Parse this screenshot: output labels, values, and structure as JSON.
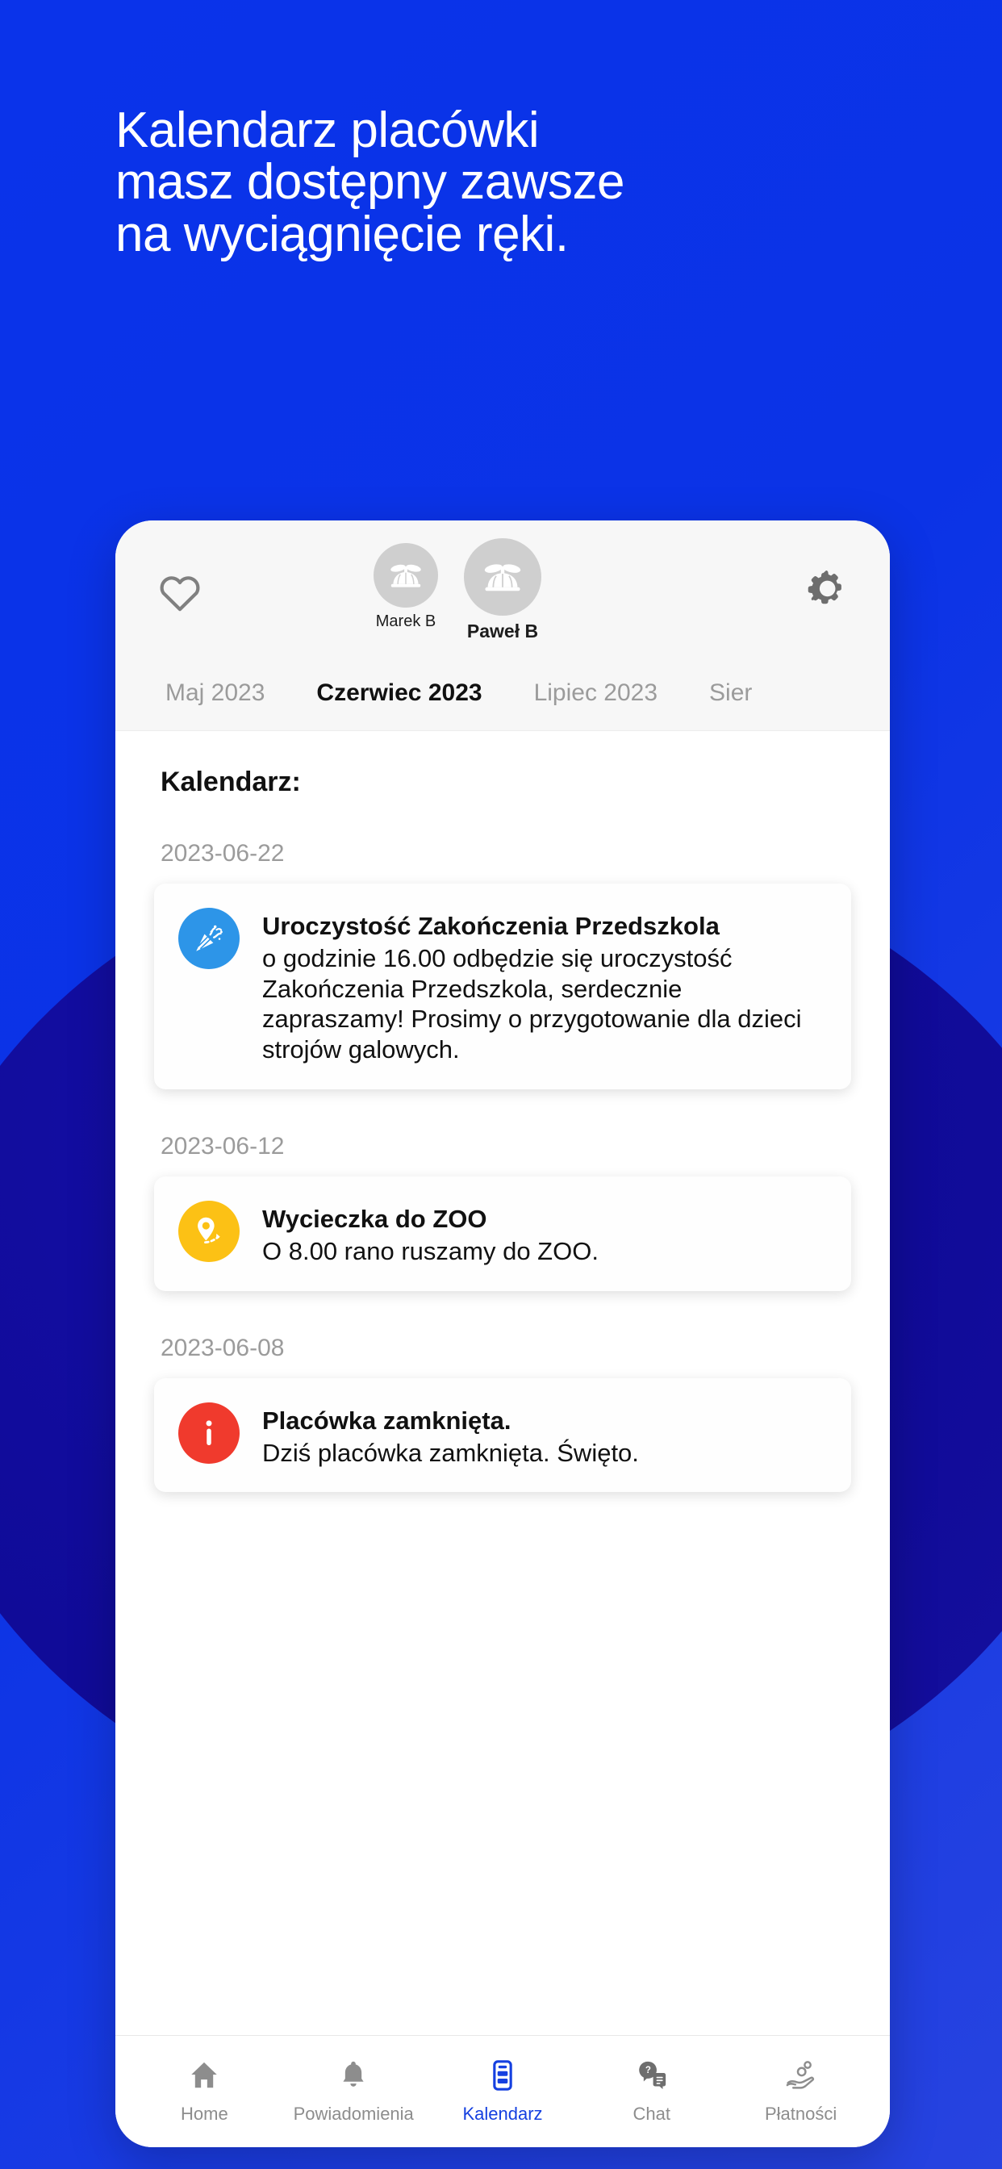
{
  "colors": {
    "background_blue": "#0a33e8",
    "background_ellipse_navy": "#110ba0",
    "accent_blue": "#1540e0",
    "event_party_blue": "#2d95e8",
    "event_zoo_yellow": "#fcc115",
    "event_closed_red": "#f03a2d",
    "muted_gray": "#9b9b9b"
  },
  "headline": {
    "text": "Kalendarz placówki\nmasz dostępny zawsze\nna wyciągnięcie ręki."
  },
  "app": {
    "header": {
      "favorite_icon": "heart-icon",
      "settings_icon": "gear-icon",
      "children": [
        {
          "name": "Marek B",
          "avatar_icon": "propeller-cap-icon",
          "selected": false
        },
        {
          "name": "Paweł B",
          "avatar_icon": "propeller-cap-icon",
          "selected": true
        }
      ]
    },
    "month_tabs": [
      {
        "label": "Maj 2023",
        "active": false
      },
      {
        "label": "Czerwiec 2023",
        "active": true
      },
      {
        "label": "Lipiec 2023",
        "active": false
      },
      {
        "label": "Sier",
        "active": false
      }
    ],
    "section_title": "Kalendarz:",
    "groups": [
      {
        "date": "2023-06-22",
        "event": {
          "icon": "party-popper-icon",
          "icon_color": "#2d95e8",
          "title": "Uroczystość Zakończenia Przedszkola",
          "description": "o godzinie 16.00 odbędzie się uroczystość Zakończenia Przedszkola, serdecznie zapraszamy! Prosimy o przygotowanie dla dzieci strojów galowych."
        }
      },
      {
        "date": "2023-06-12",
        "event": {
          "icon": "map-pin-icon",
          "icon_color": "#fcc115",
          "title": "Wycieczka do ZOO",
          "description": "O 8.00 rano ruszamy do ZOO."
        }
      },
      {
        "date": "2023-06-08",
        "event": {
          "icon": "info-circle-icon",
          "icon_color": "#f03a2d",
          "title": "Placówka zamknięta.",
          "description": "Dziś placówka zamknięta. Święto."
        }
      }
    ],
    "bottom_nav": [
      {
        "label": "Home",
        "icon": "home-icon",
        "active": false
      },
      {
        "label": "Powiadomienia",
        "icon": "bell-icon",
        "active": false
      },
      {
        "label": "Kalendarz",
        "icon": "calendar-doc-icon",
        "active": true
      },
      {
        "label": "Chat",
        "icon": "chat-question-icon",
        "active": false
      },
      {
        "label": "Płatności",
        "icon": "hand-coin-icon",
        "active": false
      }
    ]
  }
}
